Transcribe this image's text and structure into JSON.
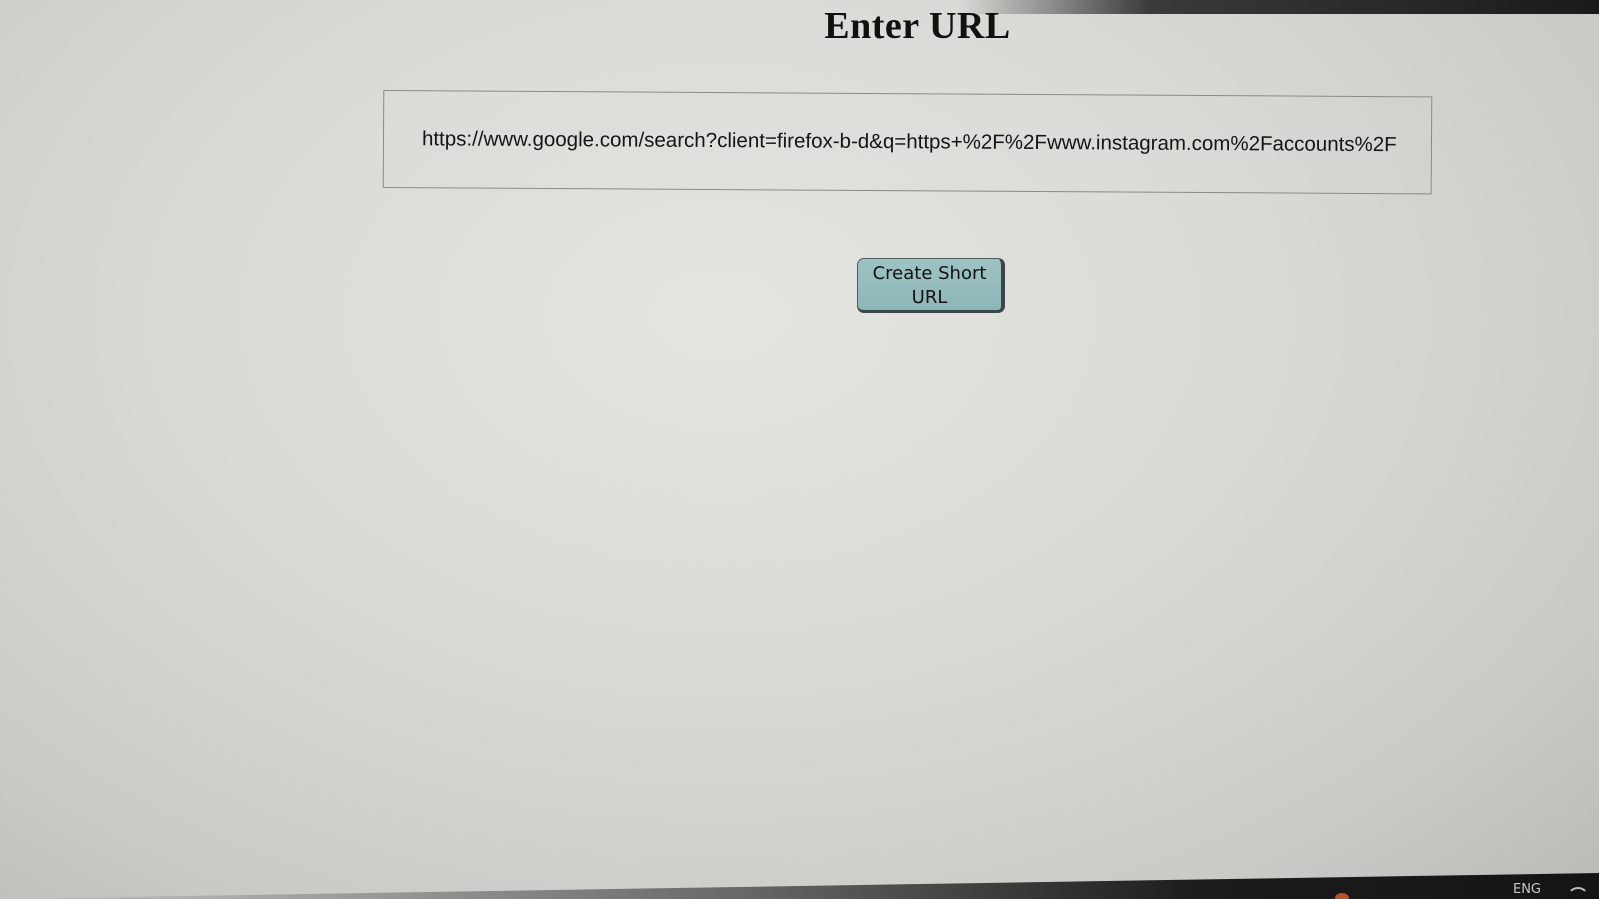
{
  "page": {
    "title": "Enter URL"
  },
  "url_input": {
    "value": "https://www.google.com/search?client=firefox-b-d&q=https+%2F%2Fwww.instagram.com%2Faccounts%2F"
  },
  "create_button": {
    "label_line1": "Create Short",
    "label_line2": "URL"
  },
  "taskbar": {
    "language": "ENG"
  },
  "colors": {
    "button_fill": "#9fc3c3",
    "button_border": "#3a4748",
    "page_background": "#dcdcd8"
  }
}
